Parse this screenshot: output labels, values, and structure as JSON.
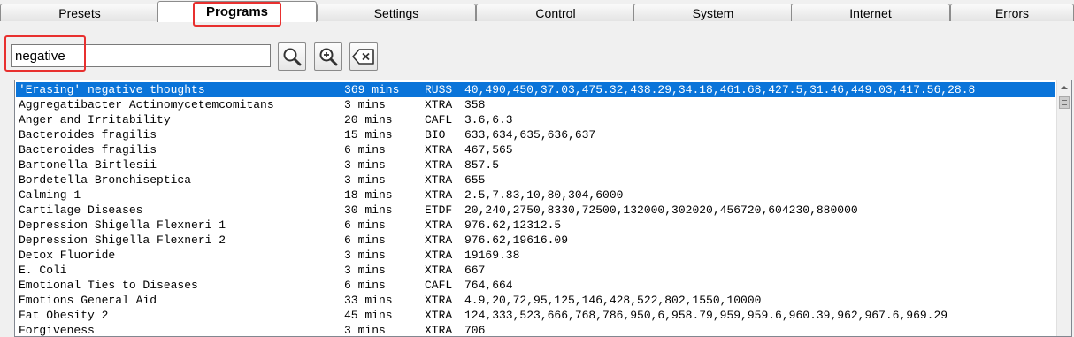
{
  "tabs": [
    {
      "label": "Presets"
    },
    {
      "label": "Programs"
    },
    {
      "label": "Settings"
    },
    {
      "label": "Control"
    },
    {
      "label": "System"
    },
    {
      "label": "Internet"
    },
    {
      "label": "Errors"
    }
  ],
  "active_tab": "Programs",
  "search": {
    "value": "negative",
    "search_icon": "search-icon",
    "zoom_icon": "zoom-in-icon",
    "clear_icon": "backspace-clear-icon"
  },
  "accent_color": "#0a74d9",
  "highlight_color": "#e8302f",
  "programs": [
    {
      "name": "'Erasing' negative thoughts",
      "duration": "369 mins",
      "type": "RUSS",
      "freqs": "40,490,450,37.03,475.32,438.29,34.18,461.68,427.5,31.46,449.03,417.56,28.8"
    },
    {
      "name": "Aggregatibacter Actinomycetemcomitans",
      "duration": "3 mins",
      "type": "XTRA",
      "freqs": "358"
    },
    {
      "name": "Anger and Irritability",
      "duration": "20 mins",
      "type": "CAFL",
      "freqs": "3.6,6.3"
    },
    {
      "name": "Bacteroides fragilis",
      "duration": "15 mins",
      "type": "BIO",
      "freqs": "633,634,635,636,637"
    },
    {
      "name": "Bacteroides fragilis",
      "duration": "6 mins",
      "type": "XTRA",
      "freqs": "467,565"
    },
    {
      "name": "Bartonella Birtlesii",
      "duration": "3 mins",
      "type": "XTRA",
      "freqs": "857.5"
    },
    {
      "name": "Bordetella Bronchiseptica",
      "duration": "3 mins",
      "type": "XTRA",
      "freqs": "655"
    },
    {
      "name": "Calming 1",
      "duration": "18 mins",
      "type": "XTRA",
      "freqs": "2.5,7.83,10,80,304,6000"
    },
    {
      "name": "Cartilage Diseases",
      "duration": "30 mins",
      "type": "ETDF",
      "freqs": "20,240,2750,8330,72500,132000,302020,456720,604230,880000"
    },
    {
      "name": "Depression Shigella Flexneri 1",
      "duration": "6 mins",
      "type": "XTRA",
      "freqs": "976.62,12312.5"
    },
    {
      "name": "Depression Shigella Flexneri 2",
      "duration": "6 mins",
      "type": "XTRA",
      "freqs": "976.62,19616.09"
    },
    {
      "name": "Detox Fluoride",
      "duration": "3 mins",
      "type": "XTRA",
      "freqs": "19169.38"
    },
    {
      "name": "E. Coli",
      "duration": "3 mins",
      "type": "XTRA",
      "freqs": "667"
    },
    {
      "name": "Emotional Ties to Diseases",
      "duration": "6 mins",
      "type": "CAFL",
      "freqs": "764,664"
    },
    {
      "name": "Emotions General Aid",
      "duration": "33 mins",
      "type": "XTRA",
      "freqs": "4.9,20,72,95,125,146,428,522,802,1550,10000"
    },
    {
      "name": "Fat Obesity 2",
      "duration": "45 mins",
      "type": "XTRA",
      "freqs": "124,333,523,666,768,786,950,6,958.79,959,959.6,960.39,962,967.6,969.29"
    },
    {
      "name": "Forgiveness",
      "duration": "3 mins",
      "type": "XTRA",
      "freqs": "706"
    }
  ]
}
